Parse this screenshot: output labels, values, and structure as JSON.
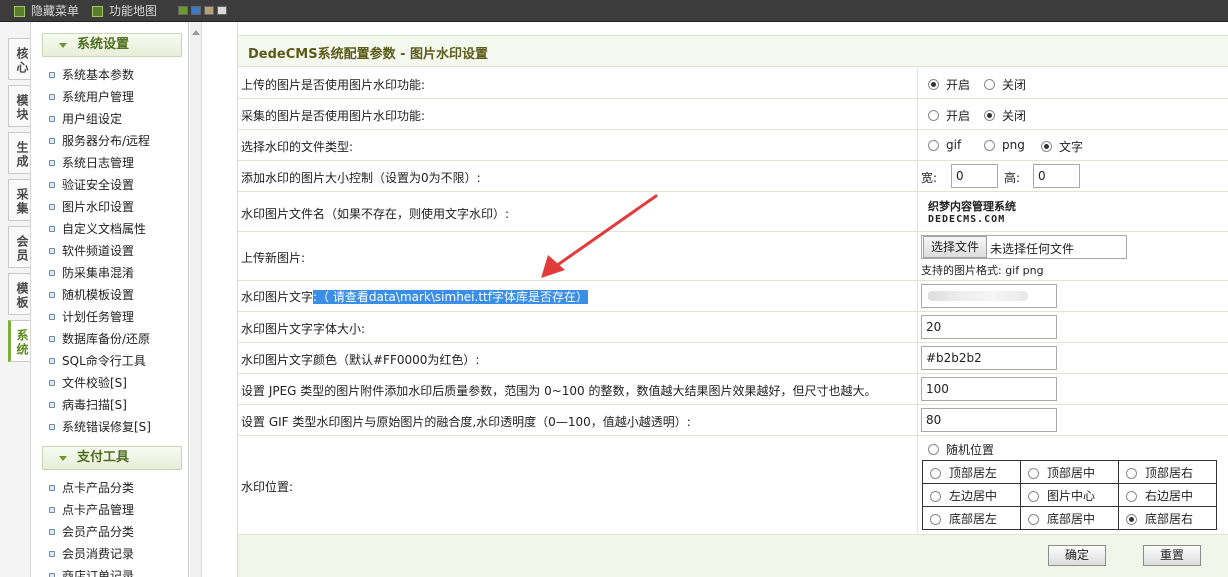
{
  "topbar": {
    "hide_menu": "隐藏菜单",
    "func_map": "功能地图",
    "swatches": [
      "#6d9a2e",
      "#3a7bc8",
      "#b5a078",
      "#d9d9d9"
    ]
  },
  "vtabs": [
    "核心",
    "模块",
    "生成",
    "采集",
    "会员",
    "模板",
    "系统"
  ],
  "vtab_active": 6,
  "menu": {
    "group1_title": "系统设置",
    "group1_items": [
      "系统基本参数",
      "系统用户管理",
      "用户组设定",
      "服务器分布/远程",
      "系统日志管理",
      "验证安全设置",
      "图片水印设置",
      "自定义文档属性",
      "软件频道设置",
      "防采集串混淆",
      "随机模板设置",
      "计划任务管理",
      "数据库备份/还原",
      "SQL命令行工具",
      "文件校验[S]",
      "病毒扫描[S]",
      "系统错误修复[S]"
    ],
    "group2_title": "支付工具",
    "group2_items": [
      "点卡产品分类",
      "点卡产品管理",
      "会员产品分类",
      "会员消费记录",
      "商店订单记录"
    ]
  },
  "main": {
    "title": "DedeCMS系统配置参数 - 图片水印设置",
    "rows": {
      "upload_wm_label": "上传的图片是否使用图片水印功能:",
      "collect_wm_label": "采集的图片是否使用图片水印功能:",
      "filetype_label": "选择水印的文件类型:",
      "size_label": "添加水印的图片大小控制（设置为0为不限）:",
      "wm_file_label": "水印图片文件名（如果不存在，则使用文字水印）:",
      "upload_new_label": "上传新图片:",
      "wm_text_label": "水印图片文字",
      "wm_text_hint": ":（ 请查看data\\mark\\simhei.ttf字体库是否存在）",
      "font_size_label": "水印图片文字字体大小:",
      "font_color_label": "水印图片文字颜色（默认#FF0000为红色）:",
      "jpeg_label": "设置 JPEG 类型的图片附件添加水印后质量参数，范围为 0~100 的整数，数值越大结果图片效果越好，但尺寸也越大。",
      "gif_label": "设置 GIF 类型水印图片与原始图片的融合度,水印透明度（0—100，值越小越透明）:",
      "position_label": "水印位置:"
    },
    "on": "开启",
    "off": "关闭",
    "types": [
      "gif",
      "png",
      "文字"
    ],
    "width_label": "宽:",
    "height_label": "高:",
    "width_value": "0",
    "height_value": "0",
    "logo_line1": "织梦内容管理系统",
    "logo_line2": "DEDECMS.COM",
    "choose_file": "选择文件",
    "no_file": "未选择任何文件",
    "supported": "支持的图片格式: gif png",
    "font_size_value": "20",
    "font_color_value": "#b2b2b2",
    "jpeg_value": "100",
    "gif_value": "80",
    "random_pos": "随机位置",
    "positions": [
      "顶部居左",
      "顶部居中",
      "顶部居右",
      "左边居中",
      "图片中心",
      "右边居中",
      "底部居左",
      "底部居中",
      "底部居右"
    ],
    "ok_button": "确定",
    "reset_button": "重置"
  },
  "accent_arrow_color": "#e23b3b",
  "highlight_color": "#3a8ee6"
}
